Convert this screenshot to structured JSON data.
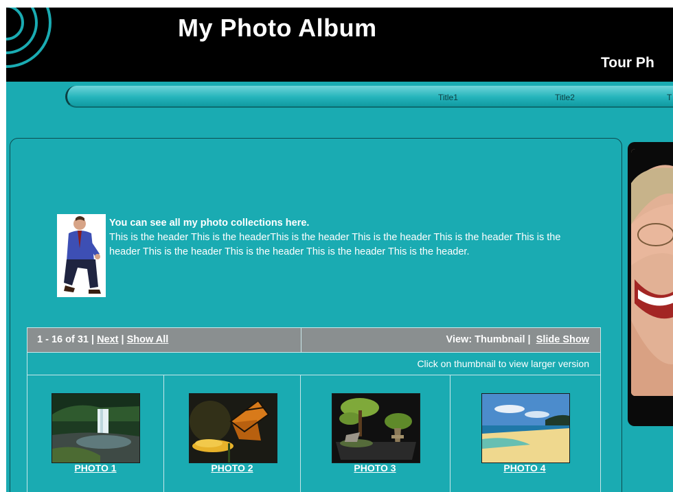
{
  "header": {
    "title": "My Photo Album",
    "subtitle": "Tour Ph"
  },
  "nav": {
    "items": [
      "Title1",
      "Title2",
      "T"
    ]
  },
  "intro": {
    "heading": "You can see all my photo collections here.",
    "body": "This is the header This is the headerThis is the header This is the header This is the header This is the header This is the header This is the header This is the header This is the header."
  },
  "gallery": {
    "range": "1 - 16 of 31",
    "next": "Next",
    "show_all": "Show All",
    "view_label": "View: Thumbnail",
    "slide_show": "Slide Show",
    "hint": "Click on thumbnail to view larger version",
    "photos": [
      {
        "caption": "PHOTO 1",
        "icon": "waterfall-photo"
      },
      {
        "caption": "PHOTO 2",
        "icon": "butterfly-photo"
      },
      {
        "caption": "PHOTO 3",
        "icon": "bonsai-photo"
      },
      {
        "caption": "PHOTO 4",
        "icon": "beach-photo"
      }
    ]
  },
  "colors": {
    "background": "#1aabb2",
    "header": "#000000",
    "gallery_header": "#8a8f90"
  }
}
